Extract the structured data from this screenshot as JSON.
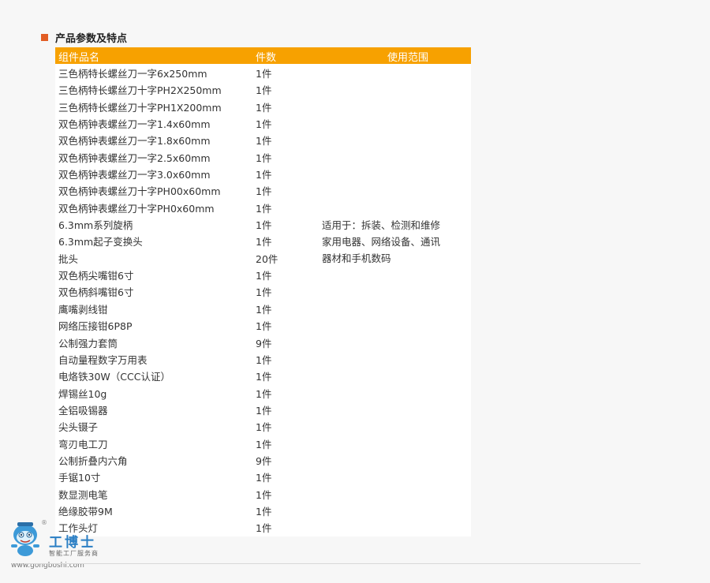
{
  "section": {
    "title": "产品参数及特点"
  },
  "table": {
    "headers": {
      "name": "组件品名",
      "qty": "件数",
      "usage": "使用范围"
    },
    "rows": [
      {
        "name": "三色柄特长螺丝刀一字6x250mm",
        "qty": "1件"
      },
      {
        "name": "三色柄特长螺丝刀十字PH2X250mm",
        "qty": "1件"
      },
      {
        "name": "三色柄特长螺丝刀十字PH1X200mm",
        "qty": "1件"
      },
      {
        "name": "双色柄钟表螺丝刀一字1.4x60mm",
        "qty": "1件"
      },
      {
        "name": "双色柄钟表螺丝刀一字1.8x60mm",
        "qty": "1件"
      },
      {
        "name": "双色柄钟表螺丝刀一字2.5x60mm",
        "qty": "1件"
      },
      {
        "name": "双色柄钟表螺丝刀一字3.0x60mm",
        "qty": "1件"
      },
      {
        "name": "双色柄钟表螺丝刀十字PH00x60mm",
        "qty": "1件"
      },
      {
        "name": "双色柄钟表螺丝刀十字PH0x60mm",
        "qty": "1件"
      },
      {
        "name": "6.3mm系列旋柄",
        "qty": "1件"
      },
      {
        "name": "6.3mm起子变换头",
        "qty": "1件"
      },
      {
        "name": "批头",
        "qty": "20件"
      },
      {
        "name": "双色柄尖嘴钳6寸",
        "qty": "1件"
      },
      {
        "name": "双色柄斜嘴钳6寸",
        "qty": "1件"
      },
      {
        "name": "鹰嘴剥线钳",
        "qty": "1件"
      },
      {
        "name": "网络压接钳6P8P",
        "qty": "1件"
      },
      {
        "name": "公制强力套筒",
        "qty": "9件"
      },
      {
        "name": "自动量程数字万用表",
        "qty": "1件"
      },
      {
        "name": "电烙铁30W（CCC认证）",
        "qty": "1件"
      },
      {
        "name": "焊锡丝10g",
        "qty": "1件"
      },
      {
        "name": "全铝吸锡器",
        "qty": "1件"
      },
      {
        "name": "尖头镊子",
        "qty": "1件"
      },
      {
        "name": "弯刃电工刀",
        "qty": "1件"
      },
      {
        "name": "公制折叠内六角",
        "qty": "9件"
      },
      {
        "name": "手锯10寸",
        "qty": "1件"
      },
      {
        "name": "数显测电笔",
        "qty": "1件"
      },
      {
        "name": "绝缘胶带9M",
        "qty": "1件"
      },
      {
        "name": "工作头灯",
        "qty": "1件"
      }
    ],
    "usage_lines": [
      "适用于：拆装、检测和维修",
      "家用电器、网络设备、通讯",
      "器材和手机数码"
    ]
  },
  "logo": {
    "name": "工博士",
    "subtitle": "智能工厂服务商",
    "url": "www.gongboshi.com",
    "reg_mark": "®"
  },
  "colors": {
    "header_bg": "#f7a100",
    "accent_square": "#e25d24",
    "logo_blue": "#2b7fc4"
  }
}
